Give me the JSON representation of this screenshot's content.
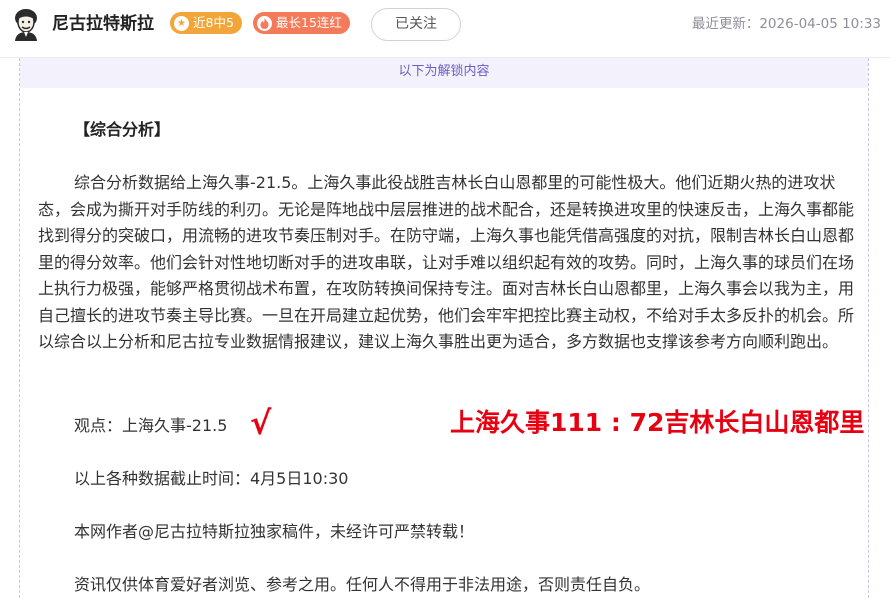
{
  "header": {
    "author_name": "尼古拉特斯拉",
    "record_badge": "近8中5",
    "streak_badge": "最长15连红",
    "follow_button": "已关注",
    "update_time": "最近更新：2026-04-05 10:33",
    "record_icon": "star-icon",
    "streak_icon": "flame-icon"
  },
  "content": {
    "unlock_notice": "以下为解锁内容",
    "section_title": "【综合分析】",
    "analysis": "综合分析数据给上海久事-21.5。上海久事此役战胜吉林长白山恩都里的可能性极大。他们近期火热的进攻状态，会成为撕开对手防线的利刃。无论是阵地战中层层推进的战术配合，还是转换进攻里的快速反击，上海久事都能找到得分的突破口，用流畅的进攻节奏压制对手。在防守端，上海久事也能凭借高强度的对抗，限制吉林长白山恩都里的得分效率。他们会针对性地切断对手的进攻串联，让对手难以组织起有效的攻势。同时，上海久事的球员们在场上执行力极强，能够严格贯彻战术布置，在攻防转换间保持专注。面对吉林长白山恩都里，上海久事会以我为主，用自己擅长的进攻节奏主导比赛。一旦在开局建立起优势，他们会牢牢把控比赛主动权，不给对手太多反扑的机会。所以综合以上分析和尼古拉专业数据情报建议，建议上海久事胜出更为适合，多方数据也支撑该参考方向顺利跑出。",
    "verdict": "观点：上海久事-21.5",
    "verdict_mark": "√",
    "final_score": "上海久事111 : 72吉林长白山恩都里",
    "cutoff_time": "以上各种数据截止时间：4月5日10:30",
    "copyright": "本网作者@尼古拉特斯拉独家稿件，未经许可严禁转载！",
    "disclaimer": "资讯仅供体育爱好者浏览、参考之用。任何人不得用于非法用途，否则责任自负。"
  },
  "colors": {
    "accent_purple": "#6a5fc4",
    "badge_orange": "#f2a63a",
    "badge_red": "#f57a5a",
    "highlight_red": "#e60012"
  }
}
